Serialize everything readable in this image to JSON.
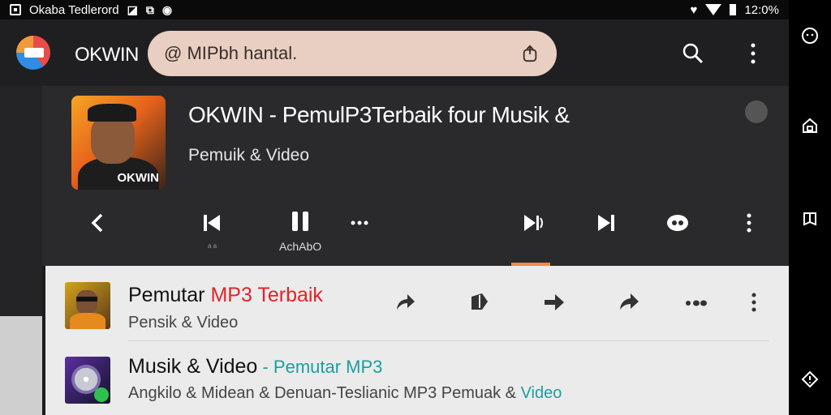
{
  "status_bar": {
    "left_text": "Okaba Tedlerord",
    "right_text": "12:0%"
  },
  "app_bar": {
    "app_name": "OKWIN",
    "search_value": "@ MIPbh hantal.",
    "icons": [
      "share-icon",
      "search-icon",
      "more-vert-icon"
    ]
  },
  "now_playing": {
    "art_text": "OKWIN",
    "title": "OKWIN - PemulP3Terbaik four Musik &",
    "subtitle": "Pemuik & Video",
    "play_label": "AchAbO",
    "tiny_label": "a a",
    "controls": [
      "back-icon",
      "previous-icon",
      "pause-icon",
      "more-horiz-icon",
      "next-alt-icon",
      "skip-next-icon",
      "cast-icon",
      "more-vert-icon"
    ]
  },
  "list": {
    "items": [
      {
        "title_plain": "Pemutar ",
        "title_accent": "MP3 Terbaik",
        "subtitle": "Pensik & Video"
      },
      {
        "title_plain": "Musik & Video",
        "title_sep": " - ",
        "title_accent": "Pemutar MP3",
        "subtitle_plain": "Angkilo & Midean & Denuan-Teslianic MP3 Pemuak & ",
        "subtitle_accent": "Video"
      }
    ]
  },
  "colors": {
    "search_bg": "#e8cfc2",
    "accent_orange": "#f08a4b",
    "title_red": "#e2232a",
    "title_teal": "#1a9f9f"
  }
}
